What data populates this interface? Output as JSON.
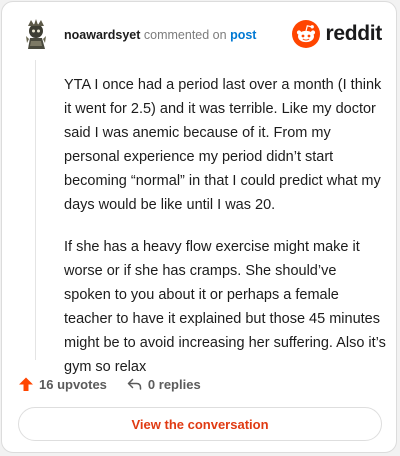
{
  "comment": {
    "username": "noawardsyet",
    "action_text": "commented on",
    "post_link_text": "post",
    "paragraphs": [
      "YTA I once had a period last over a month (I think it went for 2.5) and it was terrible. Like my doctor said I was anemic because of it. From my personal experience my period didn’t start becoming “normal” in that I could predict what my days would be like until I was 20.",
      "If she has a heavy flow exercise might make it worse or if she has cramps. She should’ve spoken to you about it or perhaps a female teacher to have it explained but those 45 minutes might be to avoid increasing her suffering. Also it’s gym so relax"
    ]
  },
  "brand": {
    "wordmark": "reddit",
    "icon": "reddit-snoo-icon",
    "color": "#ff4500"
  },
  "stats": {
    "upvotes_text": "16 upvotes",
    "replies_text": "0 replies",
    "upvote_icon": "upvote-arrow-icon",
    "reply_icon": "reply-arrow-icon",
    "upvote_color": "#ff4500"
  },
  "cta": {
    "label": "View the conversation",
    "color": "#e03a12"
  },
  "avatar": {
    "icon": "user-avatar-icon"
  }
}
